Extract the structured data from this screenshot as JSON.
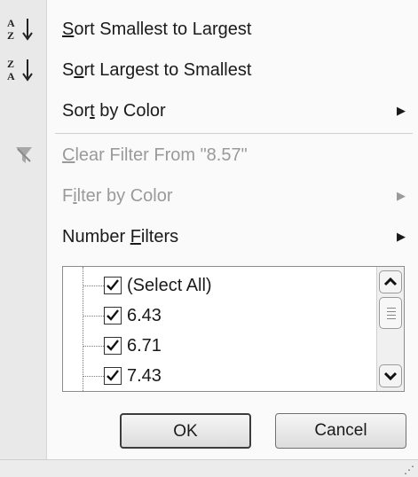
{
  "menu": {
    "sort_asc": {
      "prefix": "",
      "hot": "S",
      "rest": "ort Smallest to Largest",
      "icon": "sort-a-to-z-icon"
    },
    "sort_desc": {
      "prefix": "S",
      "hot": "o",
      "rest": "rt Largest to Smallest",
      "icon": "sort-z-to-a-icon"
    },
    "sort_color": {
      "prefix": "Sor",
      "hot": "t",
      "rest": " by Color",
      "arrow": "▶"
    },
    "clear_filter": {
      "prefix": "",
      "hot": "C",
      "rest": "lear Filter From \"8.57\"",
      "icon": "clear-filter-icon"
    },
    "filter_color": {
      "prefix": "F",
      "hot": "i",
      "rest": "lter by Color",
      "arrow": "▶"
    },
    "number_filters": {
      "prefix": "Number ",
      "hot": "F",
      "rest": "ilters",
      "arrow": "▶"
    }
  },
  "list": {
    "items": [
      {
        "label": "(Select All)",
        "checked": true
      },
      {
        "label": "6.43",
        "checked": true
      },
      {
        "label": "6.71",
        "checked": true
      },
      {
        "label": "7.43",
        "checked": true
      }
    ]
  },
  "buttons": {
    "ok": "OK",
    "cancel": "Cancel"
  }
}
